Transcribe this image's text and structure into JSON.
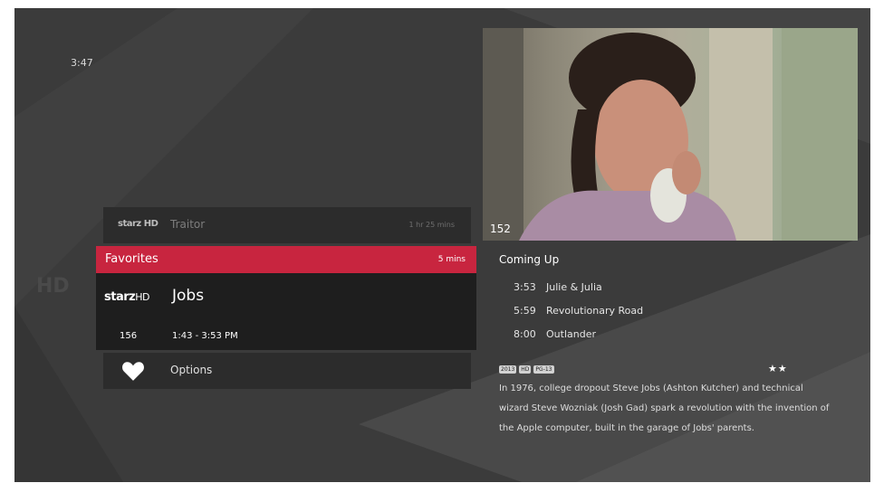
{
  "clock": "3:47",
  "previous_program": {
    "channel_logo": "starz HD",
    "title": "Traitor",
    "duration": "1 hr 25 mins"
  },
  "selected_program": {
    "category": "Favorites",
    "remaining": "5 mins",
    "channel_logo_main": "starz",
    "channel_logo_suffix": "HD",
    "title": "Jobs",
    "channel_number": "156",
    "time_range": "1:43 - 3:53 PM"
  },
  "options": {
    "icon": "heart-icon",
    "label": "Options"
  },
  "preview": {
    "channel_number": "152"
  },
  "coming_up": {
    "heading": "Coming Up",
    "items": [
      {
        "time": "3:53",
        "title": "Julie & Julia"
      },
      {
        "time": "5:59",
        "title": "Revolutionary Road"
      },
      {
        "time": "8:00",
        "title": "Outlander"
      }
    ]
  },
  "details": {
    "badges": [
      "2013",
      "HD",
      "PG-13"
    ],
    "rating_stars": "★★",
    "description": "In 1976, college dropout Steve Jobs (Ashton Kutcher) and technical wizard Steve Wozniak (Josh Gad) spark a revolution with the invention of the Apple computer, built in the garage of Jobs' parents."
  },
  "colors": {
    "accent": "#c8253f",
    "background": "#3b3b3b",
    "panel": "#1e1e1e"
  }
}
